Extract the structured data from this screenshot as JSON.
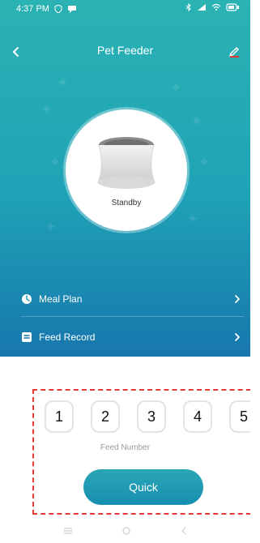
{
  "status_bar": {
    "time": "4:37 PM",
    "icons": [
      "shield-icon",
      "chat-icon"
    ],
    "right_icons": [
      "bluetooth-icon",
      "signal-icon",
      "wifi-icon",
      "battery-icon"
    ]
  },
  "header": {
    "title": "Pet Feeder",
    "back_icon": "chevron-left-icon",
    "edit_icon": "pencil-icon"
  },
  "device": {
    "status_label": "Standby"
  },
  "menu": [
    {
      "label": "Meal Plan",
      "icon": "clock-icon",
      "chevron_icon": "chevron-right-icon"
    },
    {
      "label": "Feed Record",
      "icon": "list-icon",
      "chevron_icon": "chevron-right-icon"
    }
  ],
  "feed": {
    "numbers": [
      "1",
      "2",
      "3",
      "4",
      "5"
    ],
    "label": "Feed Number"
  },
  "quick_button": {
    "label": "Quick"
  },
  "system_nav": {
    "items": [
      "menu-icon",
      "home-icon",
      "back-icon"
    ]
  },
  "colors": {
    "gradient_top": "#2bb3b3",
    "gradient_bottom": "#1777ad",
    "accent": "#1fa2b6",
    "dash": "#e53935"
  }
}
